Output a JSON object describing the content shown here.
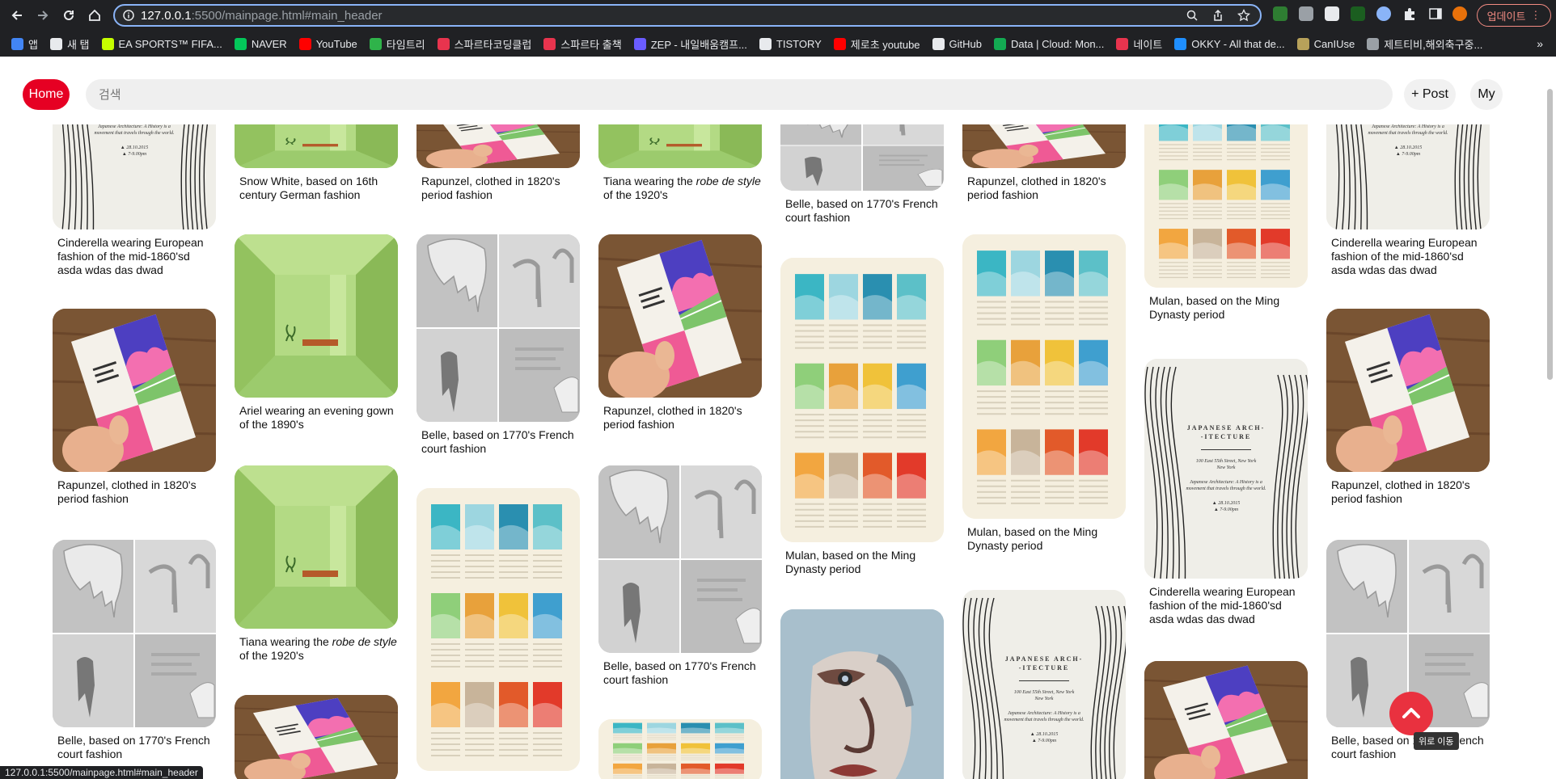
{
  "browser": {
    "url_host": "127.0.0.1",
    "url_path": ":5500/mainpage.html#main_header",
    "update_label": "업데이트",
    "bookmarks": [
      {
        "label": "앱",
        "color": "#4285f4"
      },
      {
        "label": "새 탭",
        "color": "#e8eaed"
      },
      {
        "label": "EA SPORTS™ FIFA...",
        "color": "#c6ff00"
      },
      {
        "label": "NAVER",
        "color": "#03c75a"
      },
      {
        "label": "YouTube",
        "color": "#ff0000"
      },
      {
        "label": "타임트리",
        "color": "#2fb34a"
      },
      {
        "label": "스파르타코딩클럽",
        "color": "#e8344e"
      },
      {
        "label": "스파르타 출책",
        "color": "#e8344e"
      },
      {
        "label": "ZEP - 내일배움캠프...",
        "color": "#6a5cff"
      },
      {
        "label": "TISTORY",
        "color": "#e8eaed"
      },
      {
        "label": "제로초 youtube",
        "color": "#ff0000"
      },
      {
        "label": "GitHub",
        "color": "#e8eaed"
      },
      {
        "label": "Data | Cloud: Mon...",
        "color": "#13aa52"
      },
      {
        "label": "네이트",
        "color": "#e8344e"
      },
      {
        "label": "OKKY - All that de...",
        "color": "#1f8fff"
      },
      {
        "label": "CanIUse",
        "color": "#b7a15a"
      },
      {
        "label": "제트티비,해외축구중...",
        "color": "#9aa0a6"
      }
    ],
    "more_bookmarks": "»",
    "status_url": "127.0.0.1:5500/mainpage.html#main_header"
  },
  "header": {
    "home_label": "Home",
    "search_placeholder": "검색",
    "post_label": "+ Post",
    "my_label": "My"
  },
  "pins": {
    "c0p0": "Cinderella wearing European fashion of the mid-1860'sd asda wdas das dwad",
    "c0p1": "Rapunzel, clothed in 1820's period fashion",
    "c0p2": "Belle, based on 1770's French court fashion",
    "c1p0": "Snow White, based on 16th century German fashion",
    "c1p1": "Ariel wearing an evening gown of the 1890's",
    "c1p2_a": "Tiana wearing the ",
    "c1p2_b": "robe de style",
    "c1p2_c": " of the 1920's",
    "c2p0": "Rapunzel, clothed in 1820's period fashion",
    "c2p1": "Belle, based on 1770's French court fashion",
    "c3p0_a": "Tiana wearing the ",
    "c3p0_b": "robe de style",
    "c3p0_c": " of the 1920's",
    "c3p1": "Rapunzel, clothed in 1820's period fashion",
    "c3p2": "Belle, based on 1770's French court fashion",
    "c4p0": "Belle, based on 1770's French court fashion",
    "c4p1": "Mulan, based on the Ming Dynasty period",
    "c5p0": "Rapunzel, clothed in 1820's period fashion",
    "c5p1": "Mulan, based on the Ming Dynasty period",
    "c6p0": "Mulan, based on the Ming Dynasty period",
    "c6p1": "Cinderella wearing European fashion of the mid-1860'sd asda wdas das dwad",
    "c7p0": "Cinderella wearing European fashion of the mid-1860'sd asda wdas das dwad",
    "c7p1": "Rapunzel, clothed in 1820's period fashion",
    "c7p2": "Belle, based on 1770's French court fashion"
  },
  "arch_poster": {
    "title": "JAPANESE ARCH- -ITECTURE",
    "address": "100 East 55th Street, New York",
    "city": "New York",
    "body": "Japanese Architecture: A History is a movement that travels through the world.",
    "date": "▲ 28.10.2015",
    "time": "▲ 7-9.00pm"
  },
  "scroll_top_tooltip": "위로 이동",
  "colors": {
    "accent": "#e60023",
    "scroll_top": "#e9313f"
  }
}
